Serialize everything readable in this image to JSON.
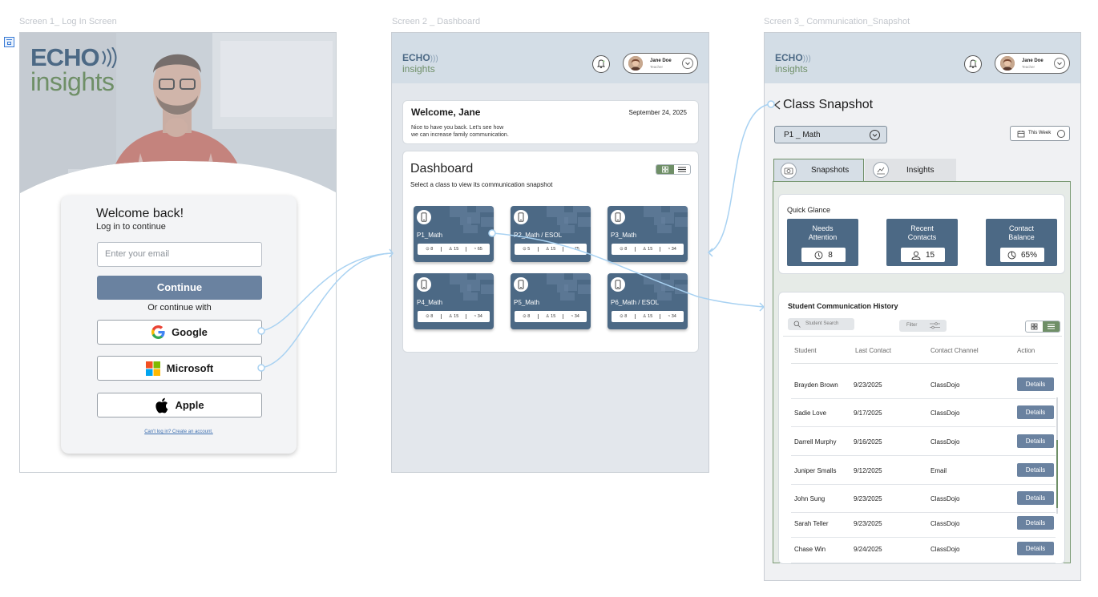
{
  "frames": {
    "s1": "Screen 1_ Log In Screen",
    "s2": "Screen 2 _ Dashboard",
    "s3": "Screen 3_ Communication_Snapshot"
  },
  "brand": {
    "echo": "ECHO",
    "insights": "insights",
    "primary": "#4c6985",
    "green": "#6f8f67",
    "button": "#6a82a0"
  },
  "login": {
    "welcome": "Welcome back!",
    "subtitle": "Log in to continue",
    "email_placeholder": "Enter your email",
    "continue": "Continue",
    "or": "Or continue with",
    "google": "Google",
    "microsoft": "Microsoft",
    "apple": "Apple",
    "cant_login": "Can't log in? Create an account."
  },
  "user": {
    "name": "Jane Doe",
    "role": "Teacher"
  },
  "dashboard": {
    "welcome": "Welcome, Jane",
    "date": "September 24, 2025",
    "message_line1": "Nice to have you back. Let's see how",
    "message_line2": "we can increase family communication.",
    "title": "Dashboard",
    "subtitle": "Select a class to view its communication snapshot",
    "classes": [
      {
        "name": "P1_Math",
        "a": "8",
        "b": "15",
        "c": "65"
      },
      {
        "name": "P2_Math / ESOL",
        "a": "5",
        "b": "15",
        "c": "75"
      },
      {
        "name": "P3_Math",
        "a": "8",
        "b": "15",
        "c": "34"
      },
      {
        "name": "P4_Math",
        "a": "8",
        "b": "15",
        "c": "34"
      },
      {
        "name": "P5_Math",
        "a": "8",
        "b": "15",
        "c": "34"
      },
      {
        "name": "P6_Math / ESOL",
        "a": "8",
        "b": "15",
        "c": "34"
      }
    ]
  },
  "snapshot": {
    "title": "Class Snapshot",
    "class_select": "P1 _ Math",
    "range": "This Week",
    "tabs": [
      "Snapshots",
      "Insights"
    ],
    "quick_glance": "Quick Glance",
    "boxes": [
      {
        "l1": "Needs",
        "l2": "Attention",
        "value": "8"
      },
      {
        "l1": "Recent",
        "l2": "Contacts",
        "value": "15"
      },
      {
        "l1": "Contact",
        "l2": "Balance",
        "value": "65%"
      }
    ],
    "history_title": "Student Communication History",
    "search_placeholder": "Student Search",
    "filter": "Filter",
    "columns": [
      "Student",
      "Last Contact",
      "Contact Channel",
      "Action"
    ],
    "details": "Details",
    "rows": [
      {
        "student": "Brayden Brown",
        "date": "9/23/2025",
        "channel": "ClassDojo"
      },
      {
        "student": "Sadie Love",
        "date": "9/17/2025",
        "channel": "ClassDojo"
      },
      {
        "student": "Darrell Murphy",
        "date": "9/16/2025",
        "channel": "ClassDojo"
      },
      {
        "student": "Juniper Smalls",
        "date": "9/12/2025",
        "channel": "Email"
      },
      {
        "student": "John Sung",
        "date": "9/23/2025",
        "channel": "ClassDojo"
      },
      {
        "student": "Sarah Teller",
        "date": "9/23/2025",
        "channel": "ClassDojo"
      },
      {
        "student": "Chase Win",
        "date": "9/24/2025",
        "channel": "ClassDojo"
      }
    ]
  }
}
